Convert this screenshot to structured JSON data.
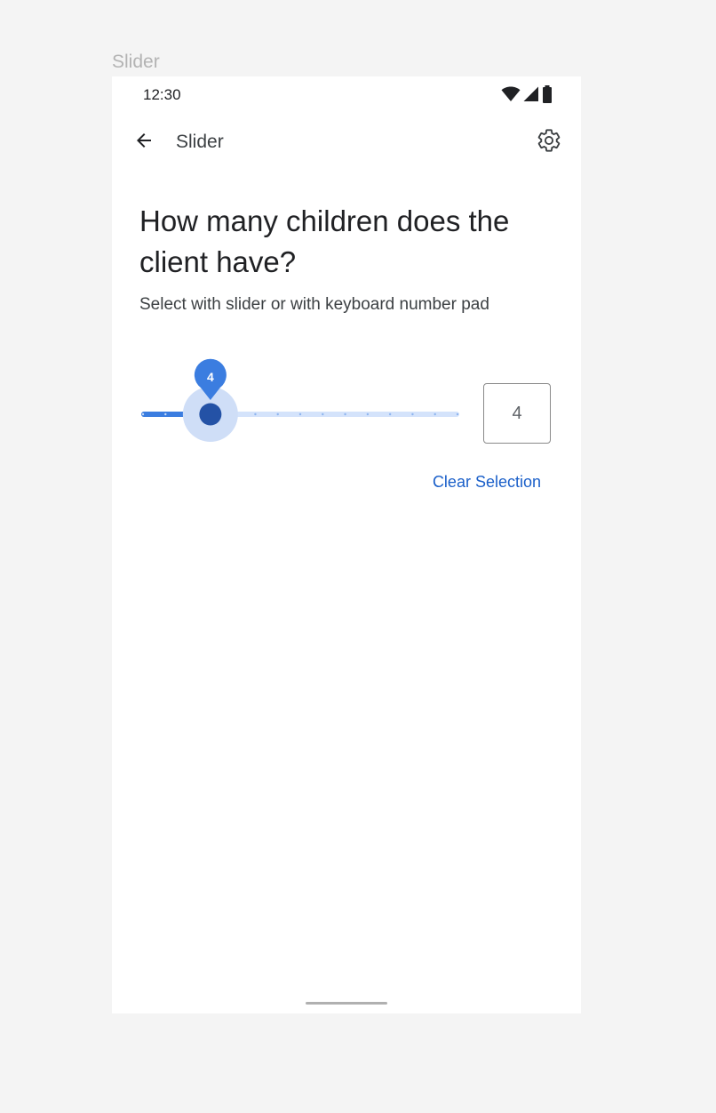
{
  "frame_label": "Slider",
  "status_bar": {
    "time": "12:30"
  },
  "app_bar": {
    "title": "Slider"
  },
  "question": {
    "title": "How many children does the client have?",
    "hint": "Select with slider or with keyboard number pad"
  },
  "slider": {
    "min": 1,
    "max": 15,
    "value": 4,
    "value_label": "4"
  },
  "value_input": {
    "value": "4"
  },
  "clear_button": {
    "label": "Clear Selection"
  },
  "colors": {
    "accent": "#3b7de0",
    "thumb": "#2452a6",
    "link": "#1a5fc9"
  }
}
